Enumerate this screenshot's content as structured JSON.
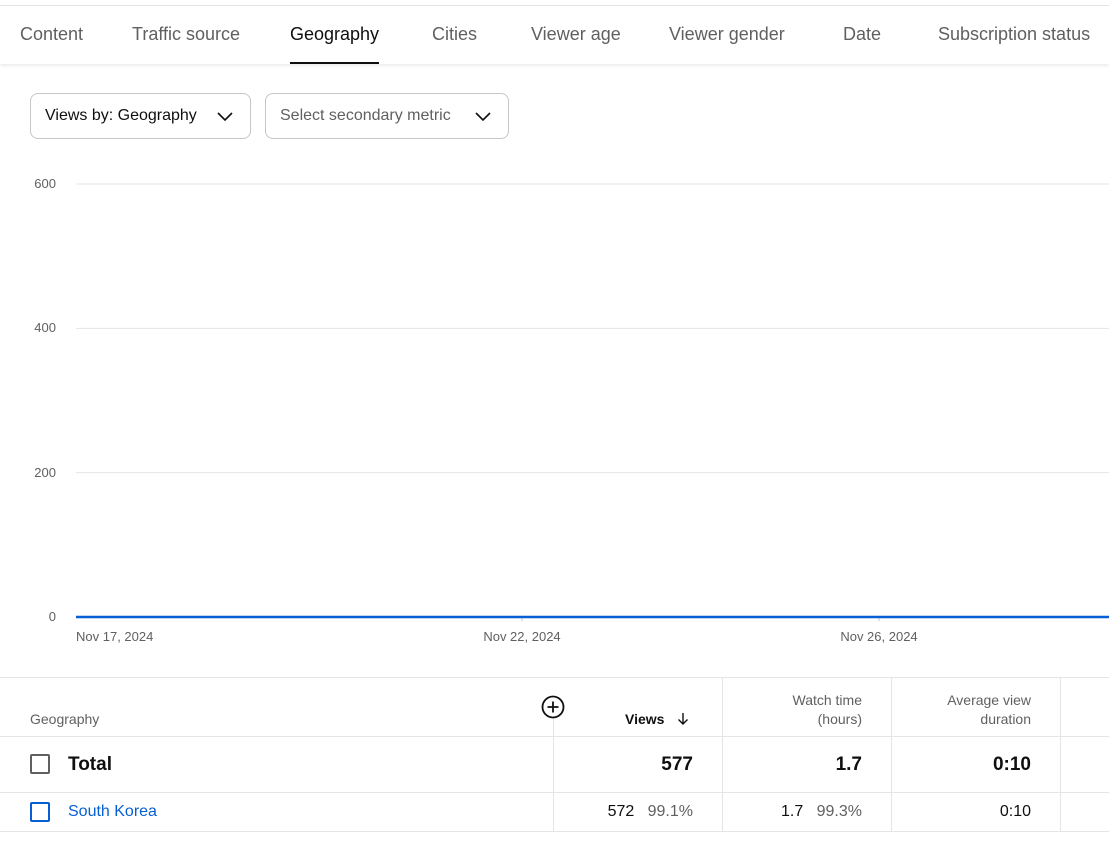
{
  "tabs": [
    {
      "label": "Content",
      "active": false
    },
    {
      "label": "Traffic source",
      "active": false
    },
    {
      "label": "Geography",
      "active": true
    },
    {
      "label": "Cities",
      "active": false
    },
    {
      "label": "Viewer age",
      "active": false
    },
    {
      "label": "Viewer gender",
      "active": false
    },
    {
      "label": "Date",
      "active": false
    },
    {
      "label": "Subscription status",
      "active": false
    }
  ],
  "controls": {
    "primary_metric": "Views by: Geography",
    "secondary_metric_placeholder": "Select secondary metric"
  },
  "chart_data": {
    "type": "line",
    "y_ticks": [
      "600",
      "400",
      "200",
      "0"
    ],
    "ylim": [
      0,
      600
    ],
    "x_ticks": [
      "Nov 17, 2024",
      "Nov 22, 2024",
      "Nov 26, 2024"
    ],
    "grid": true,
    "line_color": "#065fd4",
    "series": [
      {
        "values": [
          0,
          0,
          0,
          0,
          0,
          0,
          0,
          0,
          0,
          0,
          0,
          0,
          0,
          0
        ]
      }
    ]
  },
  "table": {
    "dimension_header": "Geography",
    "columns": [
      {
        "label": "Views",
        "sorted": true
      },
      {
        "label_line1": "Watch time",
        "label_line2": "(hours)"
      },
      {
        "label_line1": "Average view",
        "label_line2": "duration"
      }
    ],
    "total": {
      "label": "Total",
      "views": "577",
      "watch_time": "1.7",
      "avg_duration": "0:10"
    },
    "rows": [
      {
        "label": "South Korea",
        "views": "572",
        "views_pct": "99.1%",
        "watch_time": "1.7",
        "watch_pct": "99.3%",
        "avg_duration": "0:10"
      }
    ]
  },
  "colors": {
    "accent": "#065fd4",
    "text": "#0f0f0f",
    "muted": "#606060",
    "divider": "#e5e5e5"
  }
}
